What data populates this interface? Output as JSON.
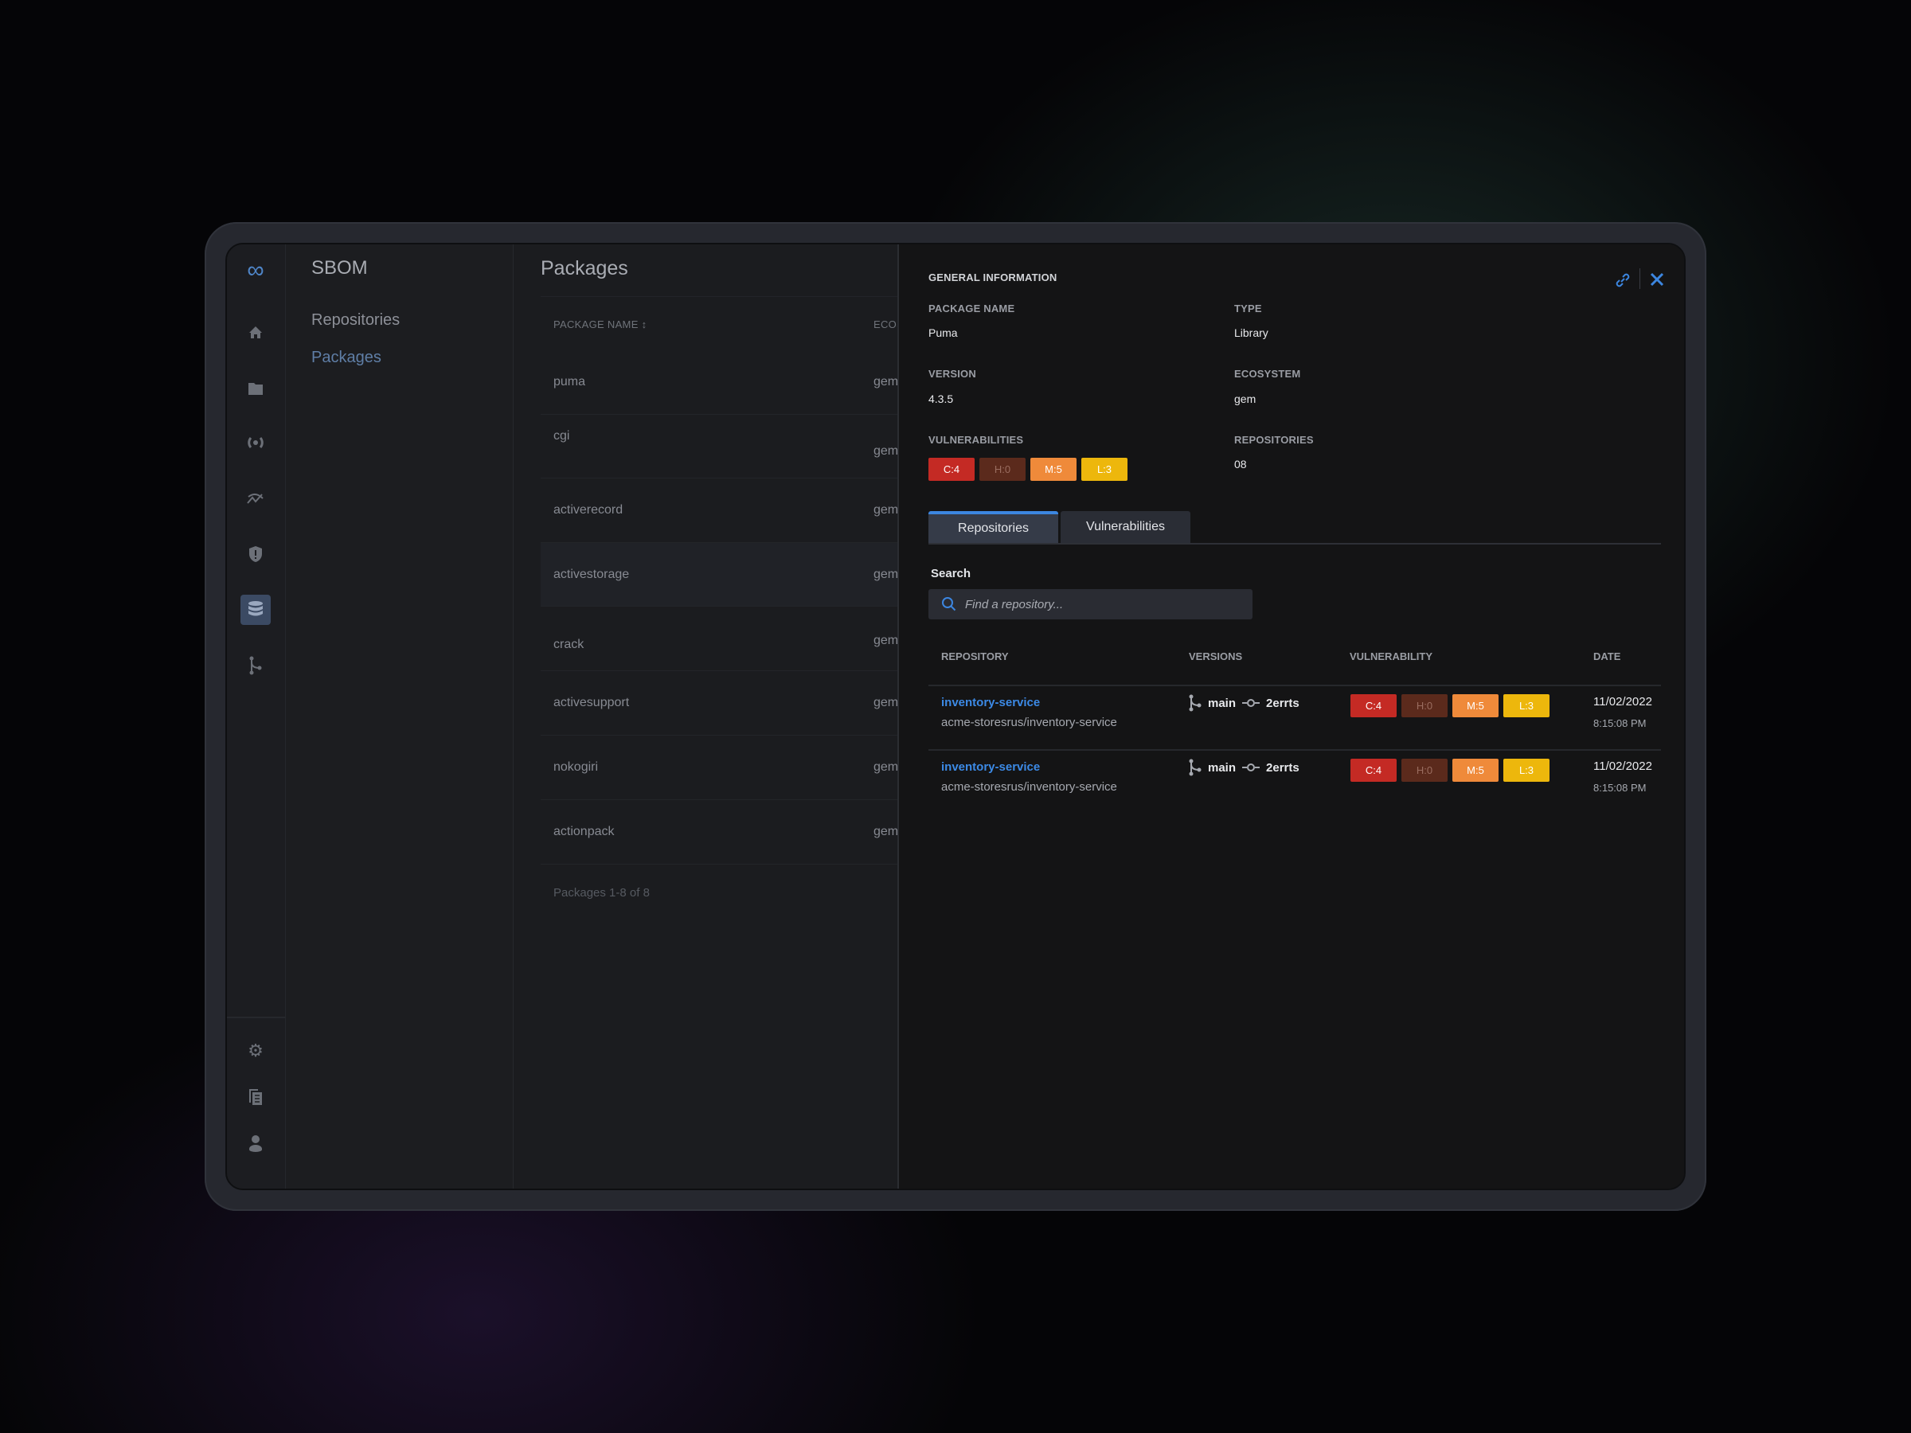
{
  "app": {
    "section_title": "SBOM",
    "nav": [
      {
        "label": "Repositories",
        "active": false
      },
      {
        "label": "Packages",
        "active": true
      }
    ],
    "rail_icons": [
      "infinity-logo-icon",
      "home-icon",
      "folder-icon",
      "broadcast-icon",
      "trend-icon",
      "shield-alert-icon",
      "database-icon",
      "branch-icon",
      "gear-icon",
      "documents-icon",
      "user-icon"
    ],
    "active_rail_icon": "database-icon"
  },
  "packages": {
    "title": "Packages",
    "columns": [
      "PACKAGE NAME ↕",
      "ECOSYSTEM"
    ],
    "rows": [
      {
        "name": "puma",
        "ecosystem": "gem"
      },
      {
        "name": "cgi",
        "ecosystem": "gem"
      },
      {
        "name": "activerecord",
        "ecosystem": "gem"
      },
      {
        "name": "activestorage",
        "ecosystem": "gem"
      },
      {
        "name": "crack",
        "ecosystem": "gem"
      },
      {
        "name": "activesupport",
        "ecosystem": "gem"
      },
      {
        "name": "nokogiri",
        "ecosystem": "gem"
      },
      {
        "name": "actionpack",
        "ecosystem": "gem"
      }
    ],
    "footer": "Packages  1-8 of 8"
  },
  "detail": {
    "heading": "GENERAL INFORMATION",
    "package_name_label": "PACKAGE NAME",
    "package_name": "Puma",
    "type_label": "TYPE",
    "type": "Library",
    "version_label": "VERSION",
    "version": "4.3.5",
    "ecosystem_label": "ECOSYSTEM",
    "ecosystem": "gem",
    "vulnerabilities_label": "VULNERABILITIES",
    "vulnerabilities": {
      "c": "C:4",
      "h": "H:0",
      "m": "M:5",
      "l": "L:3"
    },
    "repositories_label": "REPOSITORIES",
    "repositories": "08",
    "tabs": [
      {
        "label": "Repositories",
        "active": true
      },
      {
        "label": "Vulnerabilities",
        "active": false
      }
    ],
    "search_label": "Search",
    "search_placeholder": "Find a repository...",
    "search_value": "",
    "table": {
      "columns": [
        "REPOSITORY",
        "VERSIONS",
        "VULNERABILITY",
        "DATE"
      ],
      "rows": [
        {
          "name": "inventory-service",
          "path": "acme-storesrus/inventory-service",
          "branch": "main",
          "commit": "2errts",
          "vuln": {
            "c": "C:4",
            "h": "H:0",
            "m": "M:5",
            "l": "L:3"
          },
          "date": "11/02/2022",
          "time": "8:15:08 PM"
        },
        {
          "name": "inventory-service",
          "path": "acme-storesrus/inventory-service",
          "branch": "main",
          "commit": "2errts",
          "vuln": {
            "c": "C:4",
            "h": "H:0",
            "m": "M:5",
            "l": "L:3"
          },
          "date": "11/02/2022",
          "time": "8:15:08 PM"
        }
      ]
    }
  },
  "colors": {
    "accent": "#3c86e0",
    "critical": "#c42a24",
    "high": "#5b2a1c",
    "medium": "#ef8a3a",
    "low": "#edb70c"
  }
}
